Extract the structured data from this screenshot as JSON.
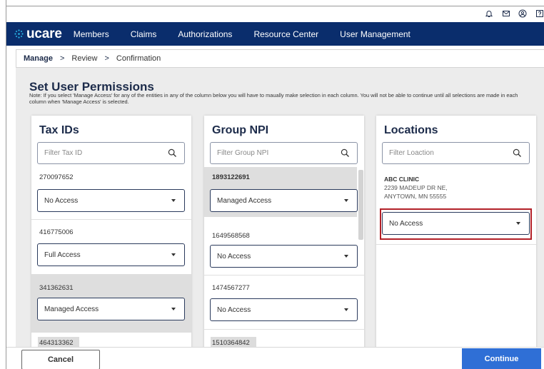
{
  "header": {
    "brand": "ucare",
    "nav": [
      "Members",
      "Claims",
      "Authorizations",
      "Resource Center",
      "User Management"
    ],
    "icons": [
      "bell-icon",
      "mail-icon",
      "user-icon",
      "help-icon"
    ]
  },
  "breadcrumb": {
    "items": [
      "Manage",
      "Review",
      "Confirmation"
    ],
    "separator": ">"
  },
  "page": {
    "title": "Set User Permissions",
    "note": "Note: If you select 'Manage Access' for any of the entities in any of the column below you will have to maually make selection in each column. You will not be able to continue until all selections are made in each column when 'Manage Access' is selected."
  },
  "tax_ids": {
    "title": "Tax IDs",
    "filter_placeholder": "Filter Tax ID",
    "entries": [
      {
        "id": "270097652",
        "access": "No Access"
      },
      {
        "id": "416775006",
        "access": "Full Access"
      },
      {
        "id": "341362631",
        "access": "Managed Access"
      },
      {
        "id": "464313362",
        "access": ""
      }
    ]
  },
  "group_npi": {
    "title": "Group NPI",
    "filter_placeholder": "Filter Group NPI",
    "entries": [
      {
        "id": "1893122691",
        "access": "Managed Access"
      },
      {
        "id": "1649568568",
        "access": "No Access"
      },
      {
        "id": "1474567277",
        "access": "No Access"
      },
      {
        "id": "1510364842",
        "access": ""
      }
    ]
  },
  "locations": {
    "title": "Locations",
    "filter_placeholder": "Filter Loaction",
    "entries": [
      {
        "name": "ABC CLINIC",
        "address1": "2239 MADEUP DR NE,",
        "address2": "ANYTOWN, MN 55555",
        "access": "No Access"
      }
    ]
  },
  "actions": {
    "cancel": "Cancel",
    "continue": "Continue"
  },
  "colors": {
    "nav_bg": "#0a2d6c",
    "continue_bg": "#2f6fd6",
    "highlight_border": "#b22028",
    "brand_accent": "#29b6e6"
  }
}
